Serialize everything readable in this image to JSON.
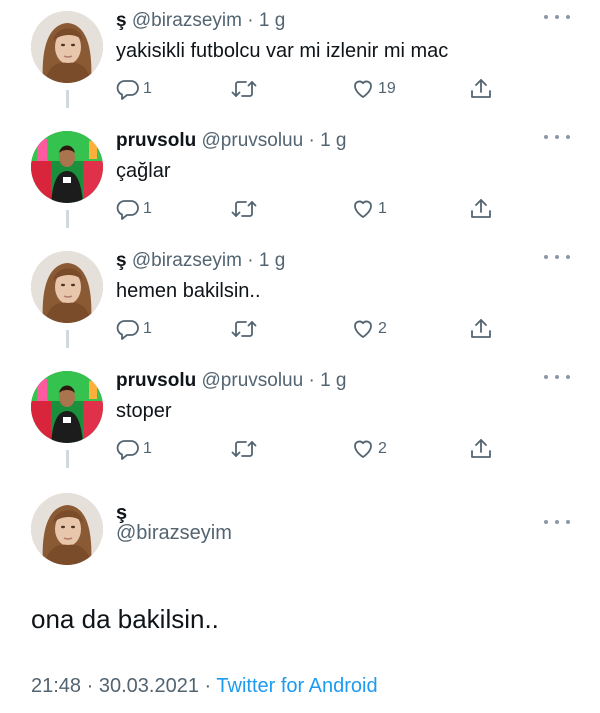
{
  "tweets": [
    {
      "display_name": "ş",
      "handle": "@birazseyim",
      "time": "1 g",
      "text": "yakisikli futbolcu var mi izlenir mi mac",
      "replies": "1",
      "retweets": "",
      "likes": "19",
      "avatar": "woman-portrait"
    },
    {
      "display_name": "pruvsolu",
      "handle": "@pruvsoluu",
      "time": "1 g",
      "text": "çağlar",
      "replies": "1",
      "retweets": "",
      "likes": "1",
      "avatar": "footballer-green-red"
    },
    {
      "display_name": "ş",
      "handle": "@birazseyim",
      "time": "1 g",
      "text": "hemen bakilsin..",
      "replies": "1",
      "retweets": "",
      "likes": "2",
      "avatar": "woman-portrait"
    },
    {
      "display_name": "pruvsolu",
      "handle": "@pruvsoluu",
      "time": "1 g",
      "text": "stoper",
      "replies": "1",
      "retweets": "",
      "likes": "2",
      "avatar": "footballer-green-red"
    }
  ],
  "main_tweet": {
    "display_name": "ş",
    "handle": "@birazseyim",
    "text": "ona da bakilsin..",
    "time": "21:48",
    "date": "30.03.2021",
    "separator": "·",
    "source": "Twitter for Android"
  },
  "ui": {
    "dot": "·",
    "icons": [
      "reply-icon",
      "retweet-icon",
      "like-icon",
      "share-icon",
      "more-icon"
    ],
    "colors": {
      "text": "#0f1419",
      "secondary": "#536471",
      "link": "#1d9bf0",
      "thread_line": "#cfd9de"
    }
  }
}
